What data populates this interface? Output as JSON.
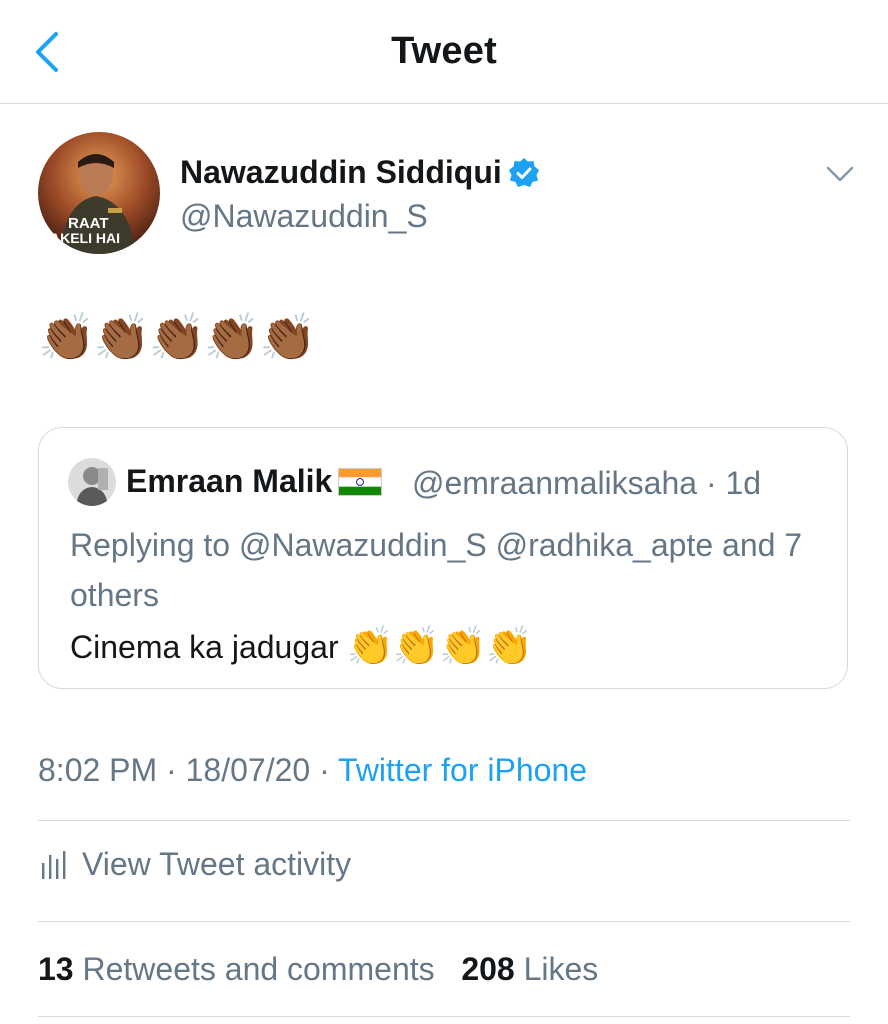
{
  "header": {
    "title": "Tweet",
    "back_icon": "chevron-left-icon"
  },
  "tweet": {
    "author": {
      "name": "Nawazuddin Siddiqui",
      "handle": "@Nawazuddin_S",
      "verified": true,
      "avatar_text_line1": "RAAT",
      "avatar_text_line2": "AKELI HAI"
    },
    "text": "👏🏾👏🏾👏🏾👏🏾👏🏾",
    "quoted": {
      "name": "Emraan Malik",
      "flag": "india-flag",
      "handle": "@emraanmaliksaha",
      "separator": "·",
      "age": "1d",
      "reply_prefix": "Replying to",
      "reply_targets": "@Nawazuddin_S @radhika_apte and 7 others",
      "text": "Cinema ka jadugar",
      "emoji": "👏👏👏👏"
    },
    "time": "8:02 PM",
    "date": "18/07/20",
    "source": "Twitter for iPhone",
    "activity_label": "View Tweet activity",
    "retweets_count": "13",
    "retweets_label": "Retweets and comments",
    "likes_count": "208",
    "likes_label": "Likes"
  },
  "colors": {
    "accent": "#1da1f2",
    "secondary_text": "#657786",
    "primary_text": "#14171a",
    "divider": "#d6dadd"
  }
}
